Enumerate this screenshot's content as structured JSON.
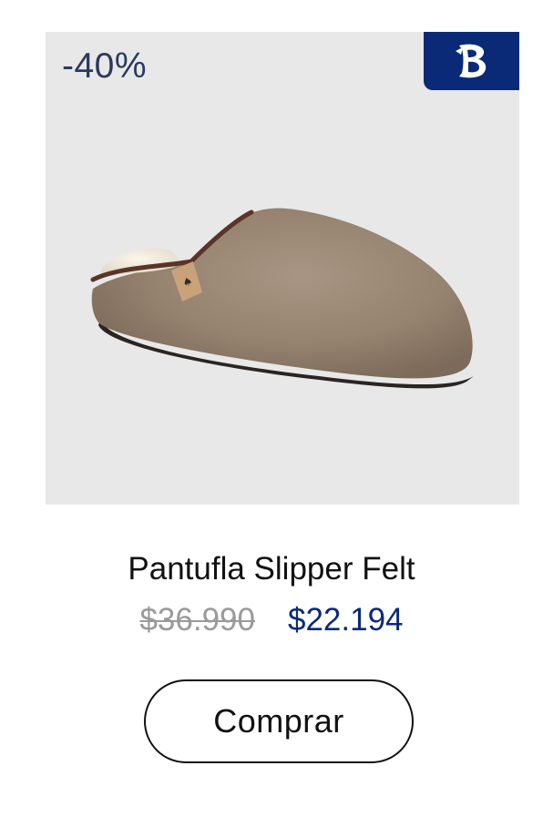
{
  "product": {
    "discount": "-40%",
    "name": "Pantufla Slipper Felt",
    "old_price": "$36.990",
    "new_price": "$22.194",
    "buy_label": "Comprar"
  },
  "brand_logo": {
    "icon": "gothic-b-logo",
    "letter": "B",
    "background": "#0a2a78"
  },
  "colors": {
    "image_background": "#e8e8e9",
    "discount_text": "#2a3a5e",
    "new_price": "#0a2a78",
    "old_price": "#9a9a9a"
  }
}
